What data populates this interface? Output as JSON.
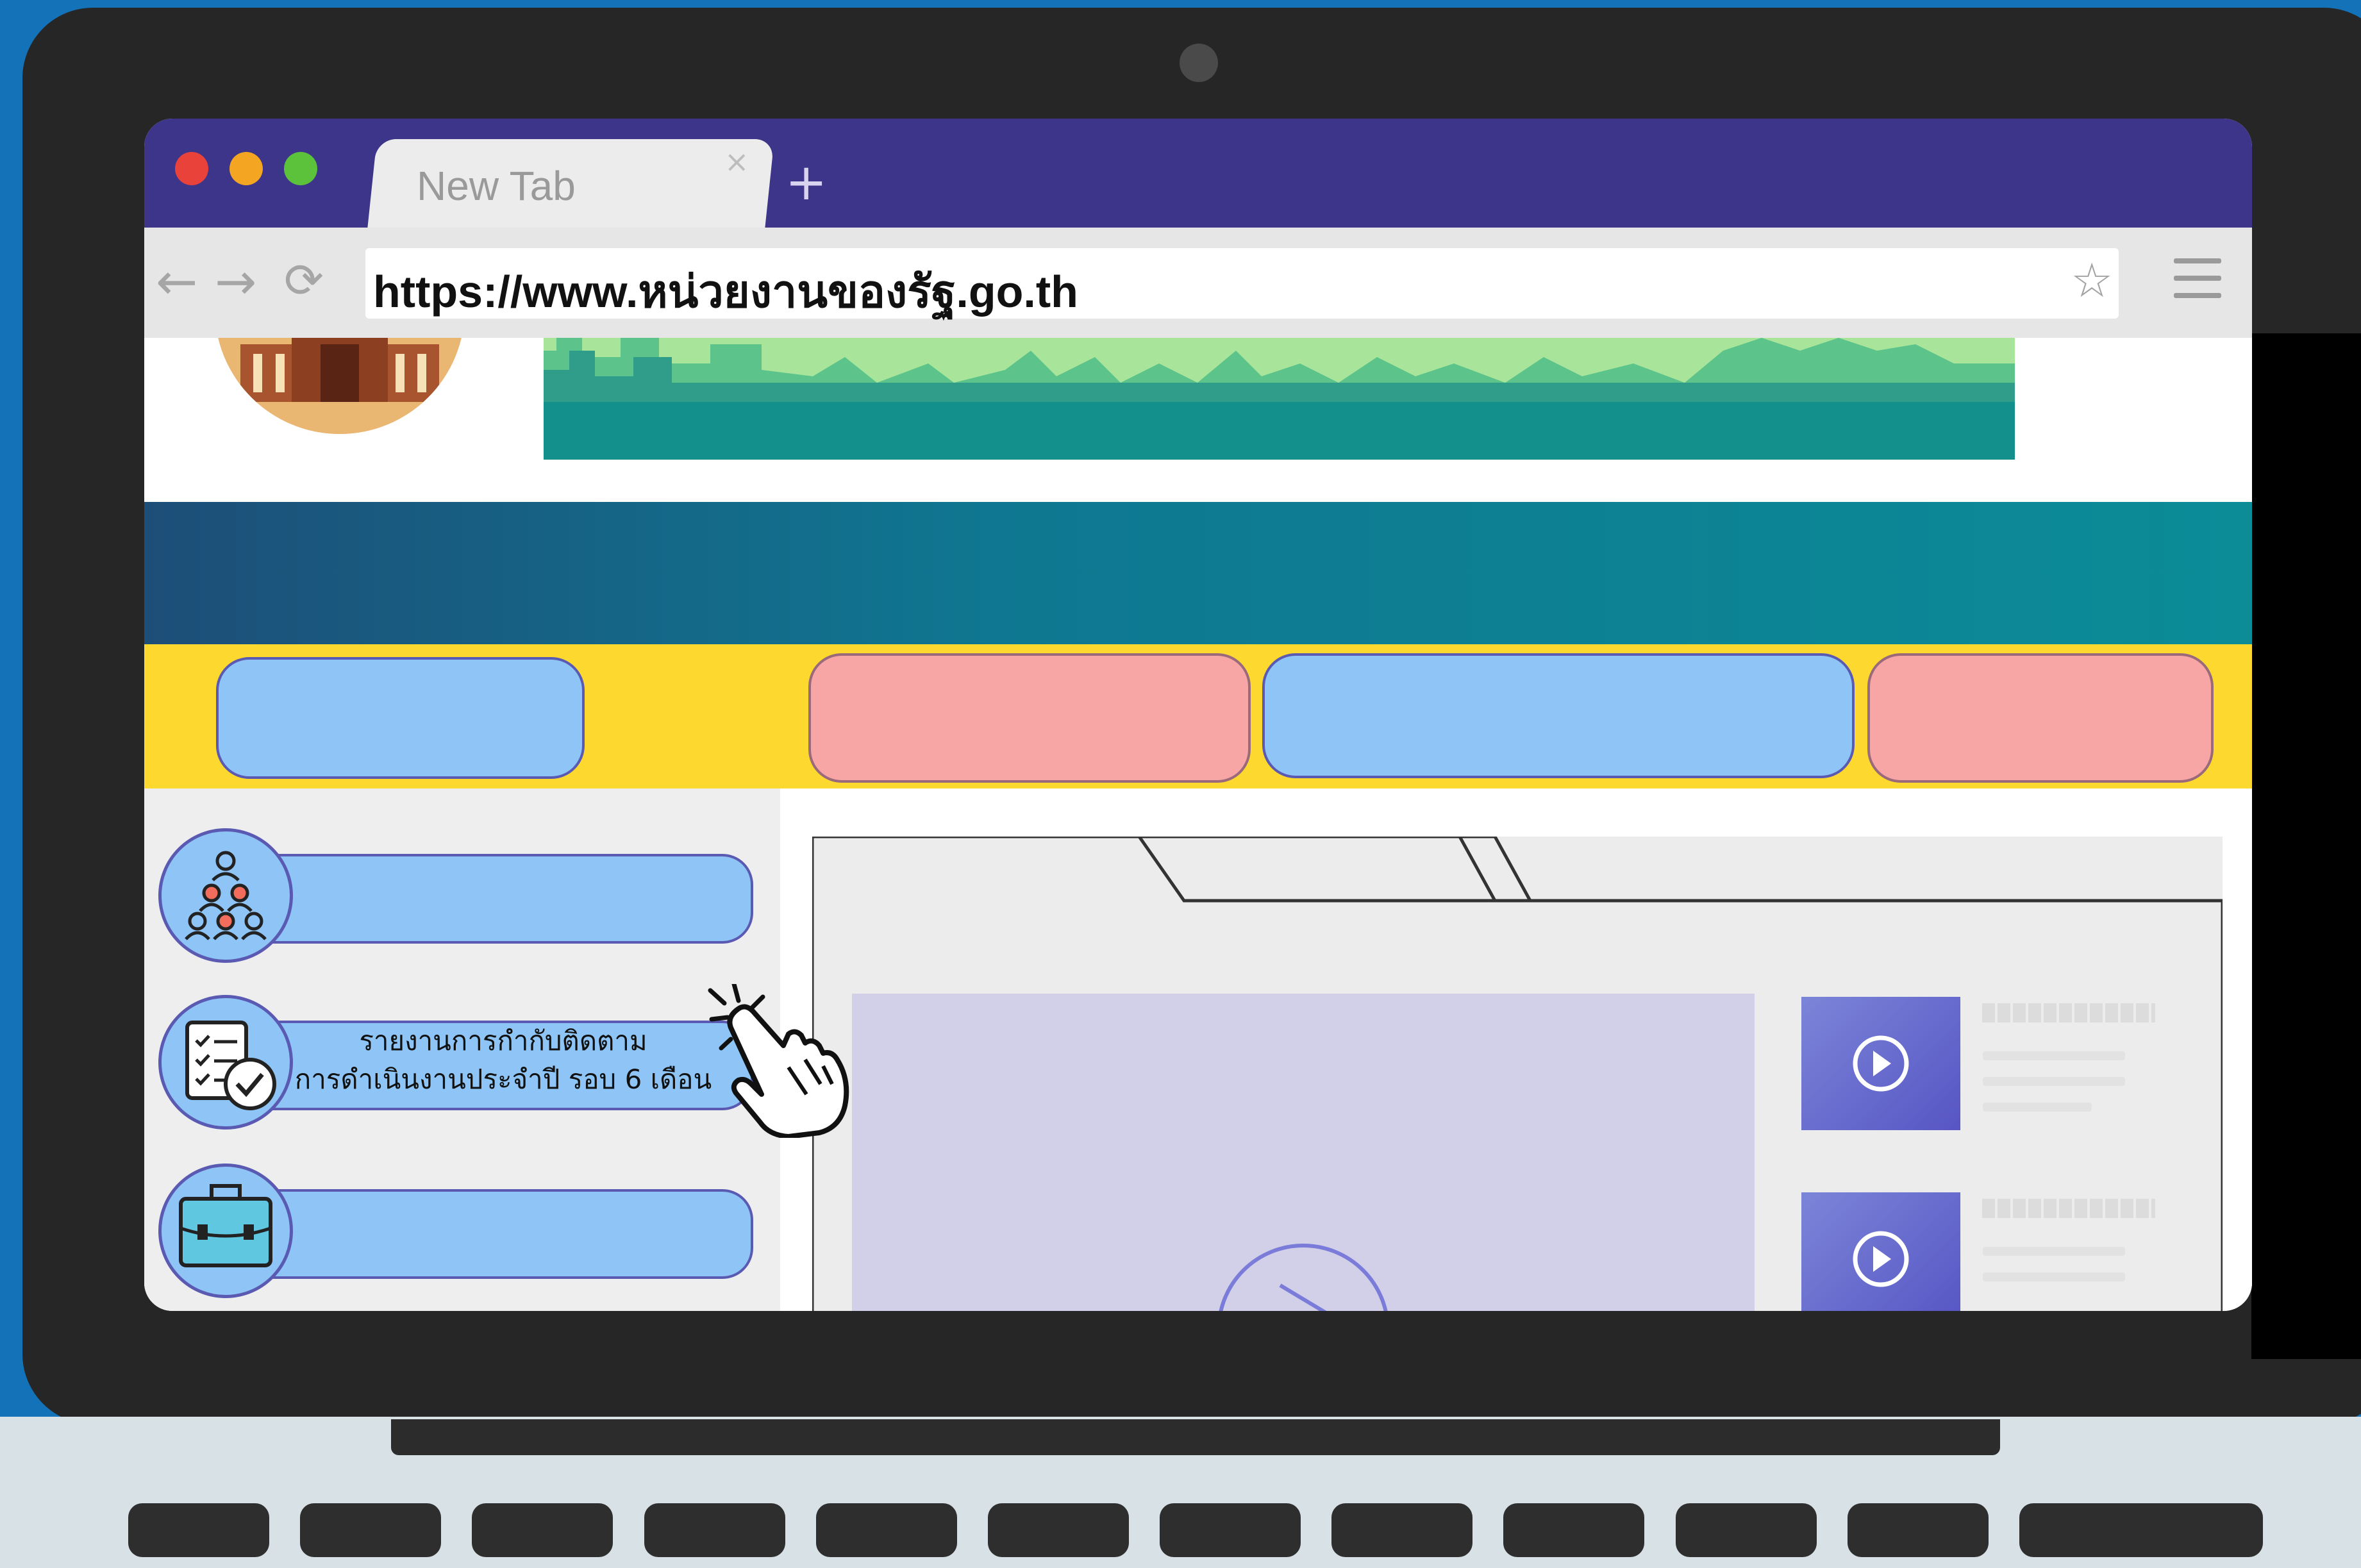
{
  "browser": {
    "tab_title": "New Tab",
    "tab_close": "×",
    "new_tab": "+",
    "url": "https://www.หน่วยงานของรัฐ.go.th",
    "nav": {
      "back": "←",
      "forward": "→",
      "reload": "⟳"
    },
    "bookmark": "☆"
  },
  "sidebar": {
    "items": [
      {
        "icon": "people-network-icon",
        "label": ""
      },
      {
        "icon": "checklist-icon",
        "label_line1": "รายงานการกำกับติดตาม",
        "label_line2": "การดำเนินงานประจำปี รอบ 6 เดือน"
      },
      {
        "icon": "briefcase-icon",
        "label": ""
      }
    ]
  },
  "nav_pills": [
    {
      "color": "blue",
      "label": ""
    },
    {
      "color": "pink",
      "label": ""
    },
    {
      "color": "blue",
      "label": ""
    },
    {
      "color": "pink",
      "label": ""
    }
  ],
  "videos": [
    {
      "title": ""
    },
    {
      "title": ""
    }
  ],
  "colors": {
    "background": "#1473b8",
    "title_bar": "#3d3589",
    "band_teal": "#0b8c97",
    "band_yellow": "#fdd82f",
    "pill_blue": "#8ec5f6",
    "pill_pink": "#f7a6a5",
    "video_panel": "#d2cfe8"
  }
}
